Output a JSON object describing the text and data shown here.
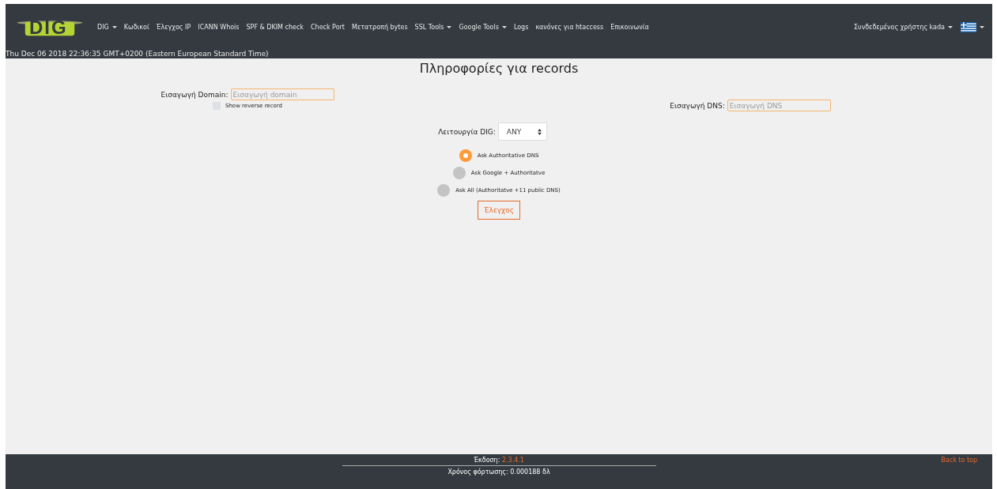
{
  "header": {
    "logo": "DIG",
    "nav": [
      {
        "label": "DIG",
        "dropdown": true
      },
      {
        "label": "Κωδικοί",
        "dropdown": false
      },
      {
        "label": "Έλεγχος IP",
        "dropdown": false
      },
      {
        "label": "ICANN Whois",
        "dropdown": false
      },
      {
        "label": "SPF & DKIM check",
        "dropdown": false
      },
      {
        "label": "Check Port",
        "dropdown": false
      },
      {
        "label": "Μετατροπή bytes",
        "dropdown": false
      },
      {
        "label": "SSL Tools",
        "dropdown": true
      },
      {
        "label": "Google Tools",
        "dropdown": true
      },
      {
        "label": "Logs",
        "dropdown": false
      },
      {
        "label": "κανόνες για htaccess",
        "dropdown": false
      },
      {
        "label": "Επικοινωνία",
        "dropdown": false
      }
    ],
    "user": {
      "label": "Συνδεδεμένος χρήστης kada",
      "dropdown": true
    },
    "language": {
      "dropdown": true
    },
    "datetime": "Thu Dec 06 2018 22:36:35 GMT+0200 (Eastern European Standard Time)"
  },
  "main": {
    "title": "Πληροφορίες για records",
    "domain": {
      "label": "Εισαγωγή Domain:",
      "placeholder": "Εισαγωγή domain"
    },
    "reverse": {
      "label": "Show reverse record",
      "checked": false
    },
    "dns": {
      "label": "Εισαγωγή DNS:",
      "placeholder": "Εισαγωγή DNS"
    },
    "mode": {
      "label": "Λειτουργία DIG:",
      "value": "ANY"
    },
    "options": [
      {
        "label": "Ask Authoritative DNS",
        "selected": true
      },
      {
        "label": "Ask Google + Authoritatve",
        "selected": false
      },
      {
        "label": "Ask All (Authoritatve +11 public DNS)",
        "selected": false
      }
    ],
    "submit": "Έλεγχος"
  },
  "footer": {
    "version_label": "Έκδοση:",
    "version": "2.3.4.1",
    "load_time": "Χρόνος φόρτωσης: 0.000188 δλ",
    "back_to_top": "Back to top"
  }
}
